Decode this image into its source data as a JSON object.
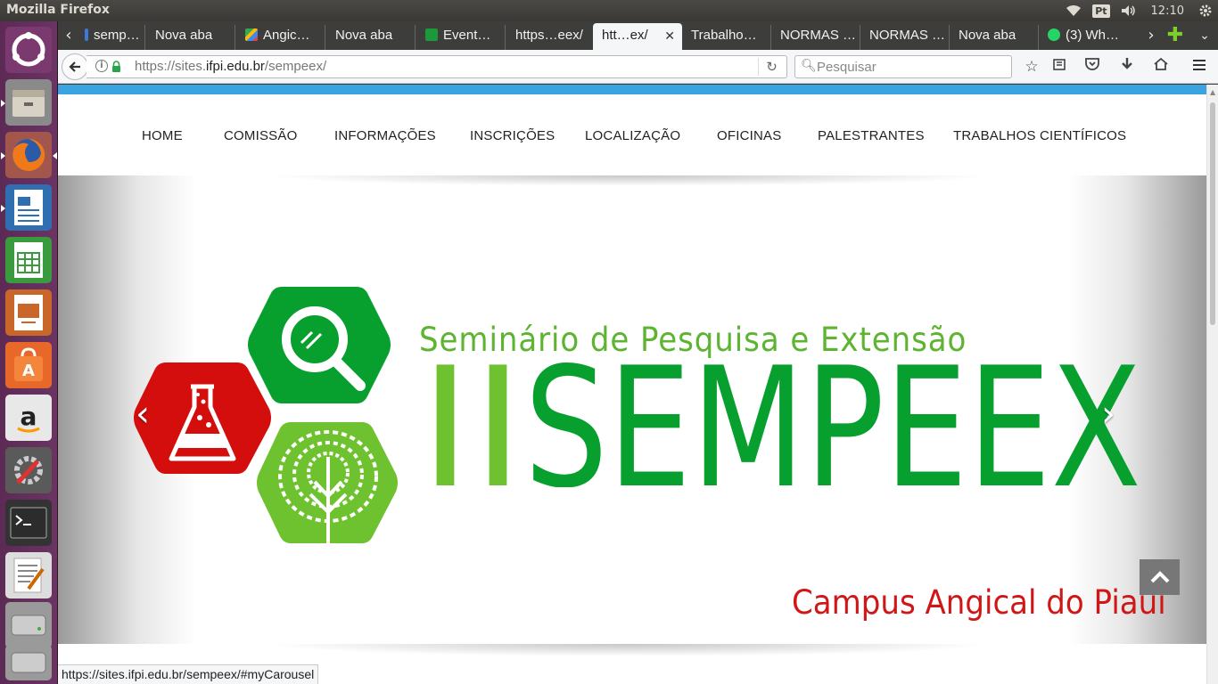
{
  "os": {
    "app_title": "Mozilla Firefox",
    "keyboard_layout": "Pt",
    "clock": "12:10"
  },
  "launcher": {
    "items": [
      "ubuntu-dash",
      "files",
      "firefox",
      "writer",
      "calc",
      "impress",
      "software-center",
      "amazon",
      "system-settings",
      "terminal",
      "text-editor",
      "drive",
      "trash"
    ]
  },
  "tabs": [
    {
      "label": "semp…",
      "favicon": "blue"
    },
    {
      "label": "Nova aba",
      "favicon": "none"
    },
    {
      "label": "Angic…",
      "favicon": "maps"
    },
    {
      "label": "Nova aba",
      "favicon": "none"
    },
    {
      "label": "Event…",
      "favicon": "brazil"
    },
    {
      "label": "https…eex/",
      "favicon": "none"
    },
    {
      "label": "htt…ex/",
      "favicon": "none",
      "active": true
    },
    {
      "label": "Trabalho…",
      "favicon": "none"
    },
    {
      "label": "NORMAS …",
      "favicon": "none"
    },
    {
      "label": "NORMAS …",
      "favicon": "none"
    },
    {
      "label": "Nova aba",
      "favicon": "none"
    },
    {
      "label": "(3) Wh…",
      "favicon": "whatsapp"
    }
  ],
  "navbar": {
    "url_prefix": "https://sites.",
    "url_host": "ifpi.edu.br",
    "url_path": "/sempeex/",
    "search_placeholder": "Pesquisar"
  },
  "site": {
    "menu": [
      "HOME",
      "COMISSÃO",
      "INFORMAÇÕES",
      "INSCRIÇÕES",
      "LOCALIZAÇÃO",
      "OFICINAS",
      "PALESTRANTES",
      "TRABALHOS CIENTÍFICOS"
    ],
    "banner": {
      "subtitle": "Seminário de Pesquisa e Extensão",
      "title_roman": "II",
      "title_main": "SEMPEEX",
      "campus": "Campus Angical do Piauí",
      "colors": {
        "dark_green": "#07a02e",
        "light_green": "#6ec22f",
        "red": "#d40d0d"
      }
    },
    "carousel_prev": "‹",
    "carousel_next": "›"
  },
  "status": {
    "hover_url": "https://sites.ifpi.edu.br/sempeex/#myCarousel"
  }
}
